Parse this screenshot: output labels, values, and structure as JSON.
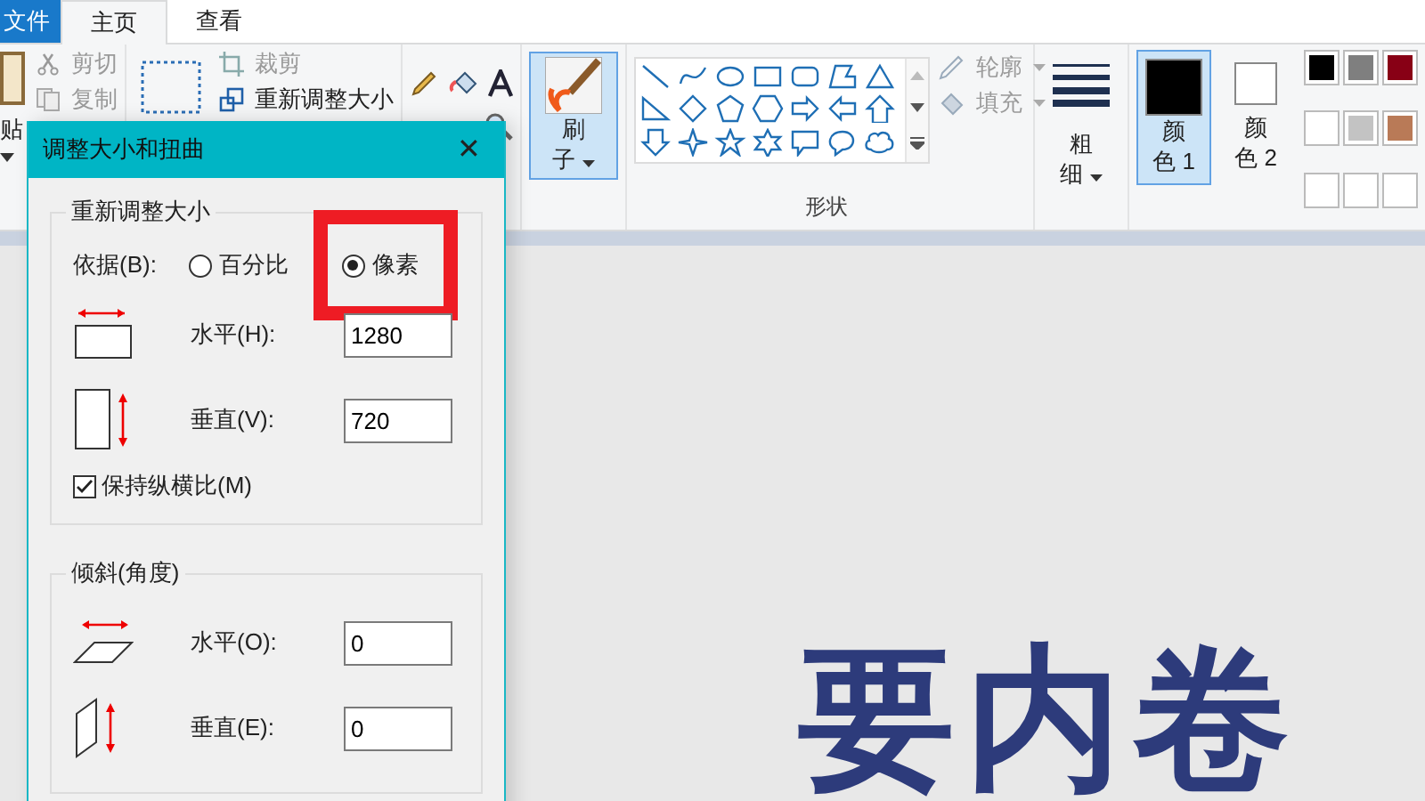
{
  "tabs": [
    {
      "label": "文件",
      "kind": "file",
      "selected": false
    },
    {
      "label": "主页",
      "kind": "tab",
      "selected": true
    },
    {
      "label": "查看",
      "kind": "tab",
      "selected": false
    }
  ],
  "ribbon": {
    "paste": "贴",
    "cut": {
      "label": "剪切",
      "disabled": true
    },
    "copy": {
      "label": "复制",
      "disabled": true
    },
    "crop": {
      "label": "裁剪",
      "disabled": true
    },
    "resize": {
      "label": "重新调整大小",
      "disabled": false
    },
    "brush": {
      "label1": "刷",
      "label2": "子",
      "selected": true
    },
    "outline": {
      "label": "轮廓",
      "disabled": true
    },
    "fill": {
      "label": "填充",
      "disabled": true
    },
    "shapes_label": "形状",
    "size": {
      "label1": "粗",
      "label2": "细"
    },
    "colors": [
      {
        "label1": "颜",
        "label2": "色 1",
        "selected": true,
        "color": "#000000"
      },
      {
        "label1": "颜",
        "label2": "色 2",
        "selected": false,
        "color": "#ffffff"
      }
    ],
    "palette": [
      {
        "kind": "color",
        "color": "#000000"
      },
      {
        "kind": "color",
        "color": "#7f7f7f"
      },
      {
        "kind": "color",
        "color": "#880015"
      },
      {
        "kind": "color",
        "color": "#ffffff"
      },
      {
        "kind": "color",
        "color": "#c3c3c3"
      },
      {
        "kind": "color",
        "color": "#b97a57"
      },
      {
        "kind": "empty"
      },
      {
        "kind": "empty"
      },
      {
        "kind": "empty"
      }
    ]
  },
  "canvas": {
    "text": "要内卷"
  },
  "dialog": {
    "title": "调整大小和扭曲",
    "close": "✕",
    "resize": {
      "legend": "重新调整大小",
      "by_label": "依据(B):",
      "options": [
        {
          "label": "百分比",
          "selected": false,
          "highlighted": false
        },
        {
          "label": "像素",
          "selected": true,
          "highlighted": true
        }
      ],
      "horizontal": {
        "label": "水平(H):",
        "value": "1280"
      },
      "vertical": {
        "label": "垂直(V):",
        "value": "720"
      },
      "keep_ratio": {
        "label": "保持纵横比(M)",
        "checked": true
      }
    },
    "skew": {
      "legend": "倾斜(角度)",
      "horizontal": {
        "label": "水平(O):",
        "value": "0"
      },
      "vertical": {
        "label": "垂直(E):",
        "value": "0"
      }
    }
  }
}
